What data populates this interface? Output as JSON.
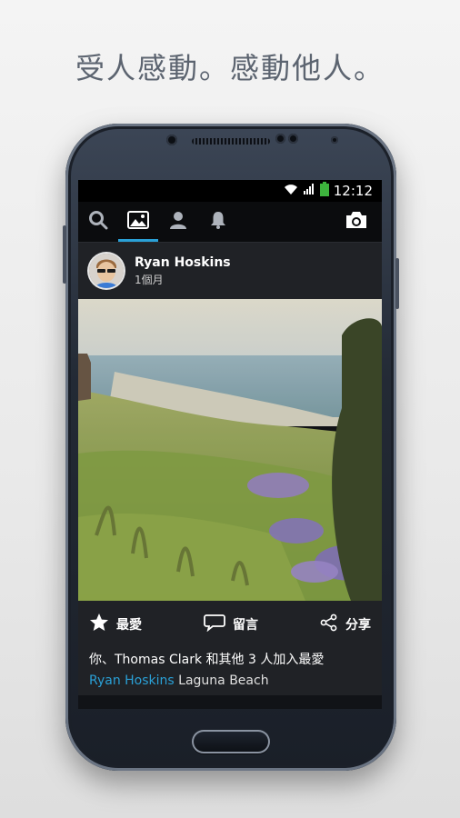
{
  "headline": "受人感動。感動他人。",
  "status": {
    "time": "12:12"
  },
  "nav": {
    "tabs": [
      {
        "icon": "search-icon"
      },
      {
        "icon": "gallery-icon",
        "active": true
      },
      {
        "icon": "person-icon"
      },
      {
        "icon": "bell-icon"
      }
    ],
    "camera_icon": "camera-icon"
  },
  "post": {
    "author": "Ryan Hoskins",
    "time": "1個月",
    "actions": {
      "like": "最愛",
      "comment": "留言",
      "share": "分享"
    },
    "likes_text": "你、Thomas Clark 和其他 3 人加入最愛",
    "location_user": "Ryan Hoskins",
    "location": "Laguna Beach"
  },
  "colors": {
    "accent": "#2aa0d6",
    "card": "#202226",
    "navbar": "#0b0c0e"
  }
}
